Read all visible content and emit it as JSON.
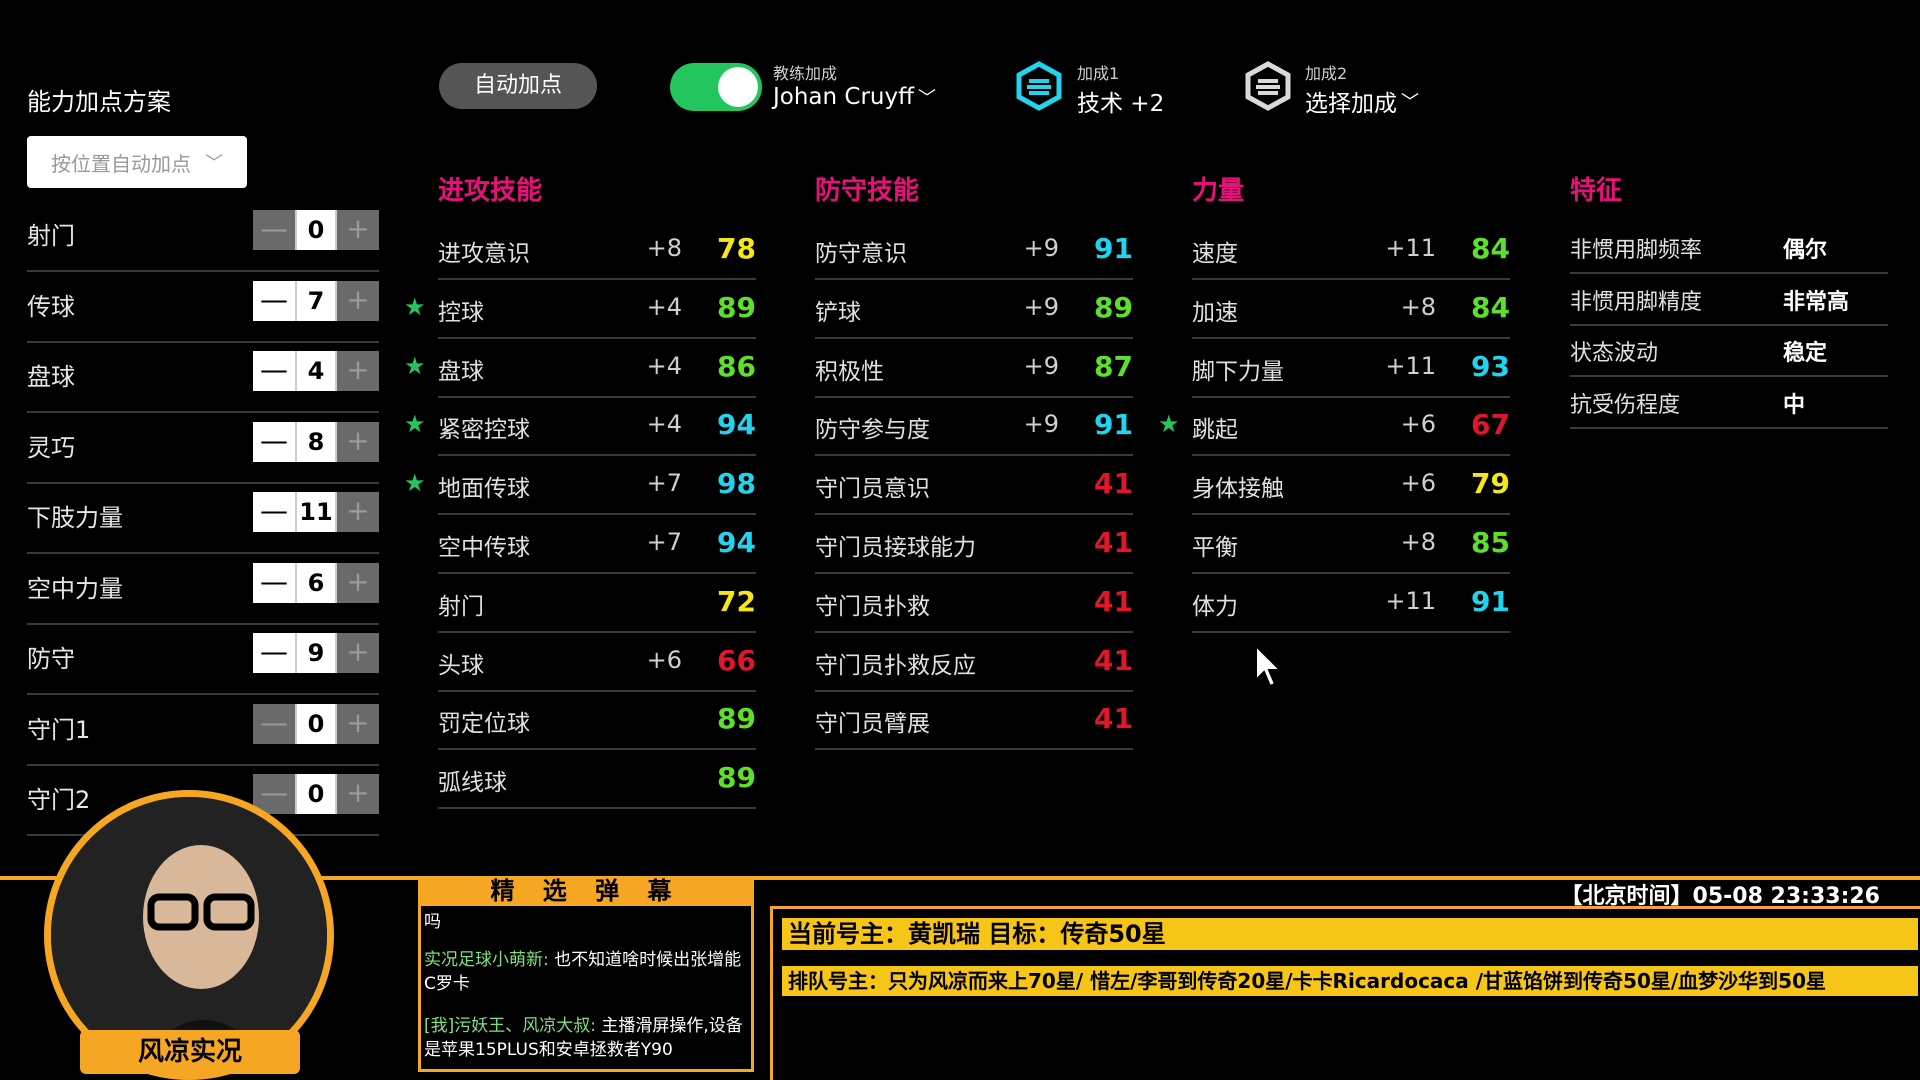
{
  "left_panel": {
    "title": "能力加点方案",
    "select_placeholder": "按位置自动加点",
    "attributes": [
      {
        "label": "射门",
        "value": "0",
        "minus_enabled": false
      },
      {
        "label": "传球",
        "value": "7",
        "minus_enabled": true
      },
      {
        "label": "盘球",
        "value": "4",
        "minus_enabled": true
      },
      {
        "label": "灵巧",
        "value": "8",
        "minus_enabled": true
      },
      {
        "label": "下肢力量",
        "value": "11",
        "minus_enabled": true
      },
      {
        "label": "空中力量",
        "value": "6",
        "minus_enabled": true
      },
      {
        "label": "防守",
        "value": "9",
        "minus_enabled": true
      },
      {
        "label": "守门1",
        "value": "0",
        "minus_enabled": false
      },
      {
        "label": "守门2",
        "value": "0",
        "minus_enabled": false
      }
    ],
    "minus_glyph": "—",
    "plus_glyph": "+"
  },
  "topbar": {
    "auto_button": "自动加点",
    "coach_label": "教练加成",
    "coach_name": "Johan Cruyff",
    "boost1_label": "加成1",
    "boost1_value": "技术 +2",
    "boost2_label": "加成2",
    "boost2_value": "选择加成",
    "toggle_color": "#22c55e"
  },
  "columns": {
    "attack": {
      "title": "进攻技能",
      "rows": [
        {
          "name": "进攻意识",
          "bonus": "+8",
          "value": "78",
          "color": "#f5e61b",
          "star": false
        },
        {
          "name": "控球",
          "bonus": "+4",
          "value": "89",
          "color": "#5ce02a",
          "star": true
        },
        {
          "name": "盘球",
          "bonus": "+4",
          "value": "86",
          "color": "#5ce02a",
          "star": true
        },
        {
          "name": "紧密控球",
          "bonus": "+4",
          "value": "94",
          "color": "#22d3ee",
          "star": true
        },
        {
          "name": "地面传球",
          "bonus": "+7",
          "value": "98",
          "color": "#22d3ee",
          "star": true
        },
        {
          "name": "空中传球",
          "bonus": "+7",
          "value": "94",
          "color": "#22d3ee",
          "star": false
        },
        {
          "name": "射门",
          "bonus": "",
          "value": "72",
          "color": "#f5e61b",
          "star": false
        },
        {
          "name": "头球",
          "bonus": "+6",
          "value": "66",
          "color": "#e0162b",
          "star": false
        },
        {
          "name": "罚定位球",
          "bonus": "",
          "value": "89",
          "color": "#5ce02a",
          "star": false
        },
        {
          "name": "弧线球",
          "bonus": "",
          "value": "89",
          "color": "#5ce02a",
          "star": false
        }
      ]
    },
    "defense": {
      "title": "防守技能",
      "rows": [
        {
          "name": "防守意识",
          "bonus": "+9",
          "value": "91",
          "color": "#22d3ee",
          "star": false
        },
        {
          "name": "铲球",
          "bonus": "+9",
          "value": "89",
          "color": "#5ce02a",
          "star": false
        },
        {
          "name": "积极性",
          "bonus": "+9",
          "value": "87",
          "color": "#5ce02a",
          "star": false
        },
        {
          "name": "防守参与度",
          "bonus": "+9",
          "value": "91",
          "color": "#22d3ee",
          "star": false
        },
        {
          "name": "守门员意识",
          "bonus": "",
          "value": "41",
          "color": "#e0162b",
          "star": false
        },
        {
          "name": "守门员接球能力",
          "bonus": "",
          "value": "41",
          "color": "#e0162b",
          "star": false
        },
        {
          "name": "守门员扑救",
          "bonus": "",
          "value": "41",
          "color": "#e0162b",
          "star": false
        },
        {
          "name": "守门员扑救反应",
          "bonus": "",
          "value": "41",
          "color": "#e0162b",
          "star": false
        },
        {
          "name": "守门员臂展",
          "bonus": "",
          "value": "41",
          "color": "#e0162b",
          "star": false
        }
      ]
    },
    "power": {
      "title": "力量",
      "rows": [
        {
          "name": "速度",
          "bonus": "+11",
          "value": "84",
          "color": "#5ce02a",
          "star": false
        },
        {
          "name": "加速",
          "bonus": "+8",
          "value": "84",
          "color": "#5ce02a",
          "star": false
        },
        {
          "name": "脚下力量",
          "bonus": "+11",
          "value": "93",
          "color": "#22d3ee",
          "star": false
        },
        {
          "name": "跳起",
          "bonus": "+6",
          "value": "67",
          "color": "#e0162b",
          "star": true
        },
        {
          "name": "身体接触",
          "bonus": "+6",
          "value": "79",
          "color": "#f5e61b",
          "star": false
        },
        {
          "name": "平衡",
          "bonus": "+8",
          "value": "85",
          "color": "#5ce02a",
          "star": false
        },
        {
          "name": "体力",
          "bonus": "+11",
          "value": "91",
          "color": "#22d3ee",
          "star": false
        }
      ]
    },
    "traits": {
      "title": "特征",
      "rows": [
        {
          "name": "非惯用脚频率",
          "value": "偶尔"
        },
        {
          "name": "非惯用脚精度",
          "value": "非常高"
        },
        {
          "name": "状态波动",
          "value": "稳定"
        },
        {
          "name": "抗受伤程度",
          "value": "中"
        }
      ]
    }
  },
  "stream": {
    "danmu_title": "精 选 弹 幕",
    "danmu": [
      {
        "user": "",
        "text": "吗"
      },
      {
        "user": "实况足球小萌新:",
        "text": " 也不知道啥时候出张增能C罗卡"
      },
      {
        "user": "[我]污妖王、风凉大叔:",
        "text": " 主播滑屏操作,设备是苹果15PLUS和安卓拯救者Y90"
      }
    ],
    "clock": "【北京时间】05-08 23:33:26",
    "owner_line": "当前号主：黄凯瑞      目标：传奇50星",
    "queue_line": "排队号主：只为风凉而来上70星/ 惜左/李哥到传奇20星/卡卡Ricardocaca /甘蓝馅饼到传奇50星/血梦沙华到50星",
    "streamer_name": "风凉实况",
    "accent": "#f5a623"
  }
}
